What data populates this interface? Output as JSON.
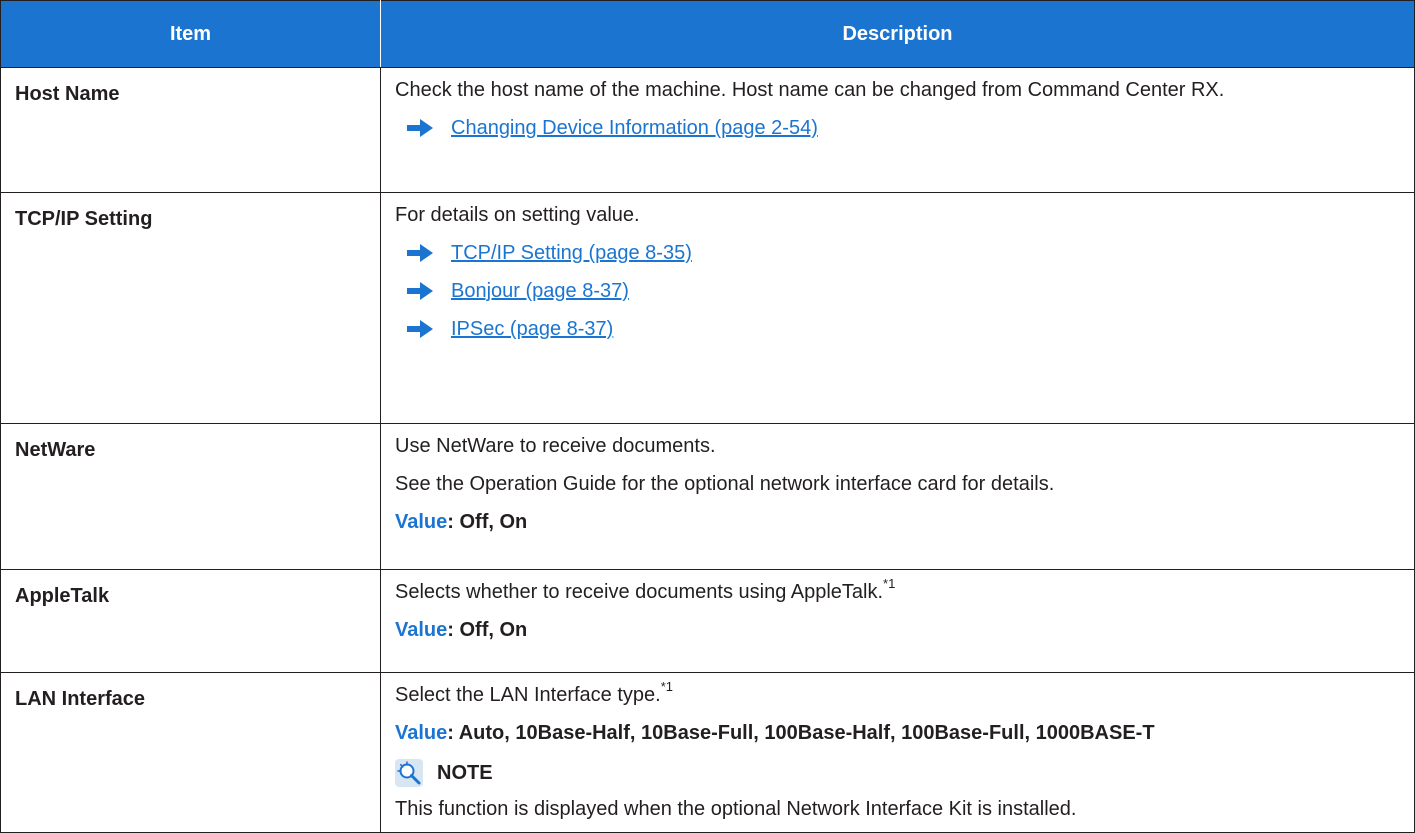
{
  "header": {
    "item": "Item",
    "description": "Description"
  },
  "rows": [
    {
      "item": "Host Name",
      "text": "Check the host name of the machine. Host name can be changed from Command Center RX.",
      "link": "Changing Device Information (page 2-54)"
    },
    {
      "item": "TCP/IP Setting",
      "text": "For details on setting value.",
      "links": [
        "TCP/IP Setting (page 8-35)",
        "Bonjour (page 8-37)",
        "IPSec (page 8-37)"
      ]
    },
    {
      "item": "NetWare",
      "text1": "Use NetWare to receive documents.",
      "text2": "See the Operation Guide for the optional network interface card for details.",
      "value_label": "Value",
      "value": ": Off, On"
    },
    {
      "item": "AppleTalk",
      "text": "Selects whether to receive documents using AppleTalk.",
      "footnote": "*1",
      "value_label": "Value",
      "value": ": Off, On"
    },
    {
      "item": "LAN Interface",
      "text": "Select the LAN Interface type.",
      "footnote": "*1",
      "value_label": "Value",
      "value": ": Auto, 10Base-Half, 10Base-Full, 100Base-Half, 100Base-Full, 1000BASE-T",
      "note_title": "NOTE",
      "note_text": "This function is displayed when the optional Network Interface Kit is installed."
    }
  ],
  "colors": {
    "accent": "#1b75d0",
    "text": "#231f20",
    "header_text": "#ffffff"
  },
  "icons": {
    "link_arrow": "arrow-right-icon",
    "note": "note-lightbulb-icon"
  }
}
